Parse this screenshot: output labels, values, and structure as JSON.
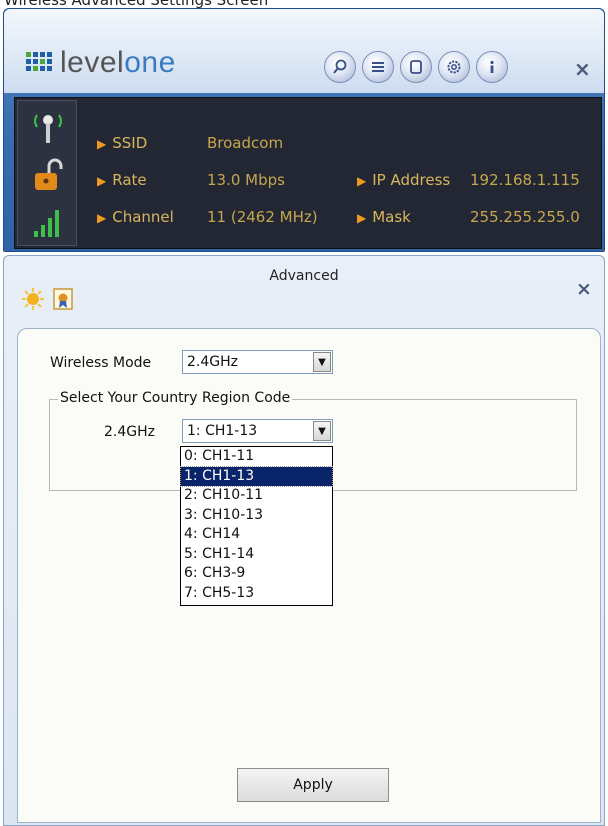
{
  "top_caption": "Wireless Advanced Settings Screen",
  "app": {
    "brand_left": "level",
    "brand_right": "one",
    "header_icons": [
      "search-icon",
      "list-icon",
      "page-icon",
      "gear-icon",
      "info-icon"
    ],
    "close_label": "×"
  },
  "status": {
    "ssid_label": "SSID",
    "ssid_value": "Broadcom",
    "rate_label": "Rate",
    "rate_value": "13.0 Mbps",
    "channel_label": "Channel",
    "channel_value": "11 (2462 MHz)",
    "ip_label": "IP Address",
    "ip_value": "192.168.1.115",
    "mask_label": "Mask",
    "mask_value": "255.255.255.0"
  },
  "advanced": {
    "title": "Advanced",
    "close_label": "×",
    "wireless_mode_label": "Wireless Mode",
    "wireless_mode_value": "2.4GHz",
    "group_title": "Select Your Country Region Code",
    "band_label": "2.4GHz",
    "region_value": "1: CH1-13",
    "region_options": [
      "0: CH1-11",
      "1: CH1-13",
      "2: CH10-11",
      "3: CH10-13",
      "4: CH14",
      "5: CH1-14",
      "6: CH3-9",
      "7: CH5-13"
    ],
    "selected_index": 1,
    "apply_label": "Apply"
  },
  "colors": {
    "status_bg": "#222733",
    "status_text": "#c6a64d",
    "arrow": "#f09a20",
    "selection": "#0a246a"
  }
}
